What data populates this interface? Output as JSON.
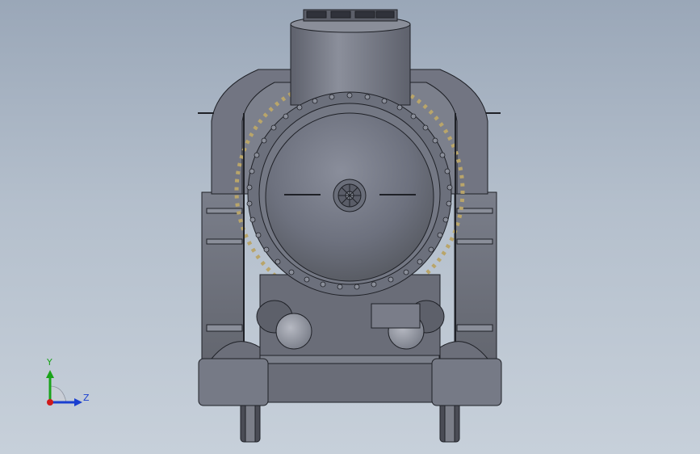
{
  "viewport": {
    "background_top": "#9aa7b8",
    "background_bottom": "#c7d0da",
    "model_color": "#6f7280",
    "model_highlight": "#9aa0ad",
    "model_edge": "#1f2127",
    "brass_color": "#b9a56a"
  },
  "triad": {
    "y_label": "Y",
    "z_label": "Z",
    "y_color": "#1aa31a",
    "z_color": "#1a3fd0",
    "x_color": "#d01a1a"
  }
}
